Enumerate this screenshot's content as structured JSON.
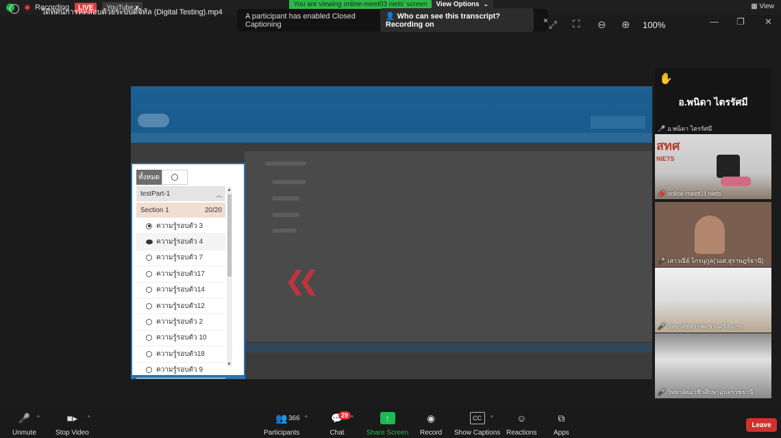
{
  "recording": {
    "label": "Recording",
    "live": "LIVE",
    "stream_target": "YouTube"
  },
  "share_banner": {
    "text": "You are viewing online-meet03 niets' screen",
    "view_options": "View Options"
  },
  "view_menu": "View",
  "file_title": "วีดิทัศน์การทดสอบด้วยระบบดิจิทัล (Digital Testing).mp4",
  "toast": {
    "message": "A participant has enabled Closed Captioning",
    "button": "Who can see this transcript? Recording on",
    "close": "×"
  },
  "zoom_level": "100%",
  "side_panel": {
    "tab_all": "ทั้งหมด",
    "part": "testPart-1",
    "section": "Section 1",
    "section_count": "20/20",
    "items": [
      {
        "label": "ความรู้รอบตัว 3",
        "state": "answered"
      },
      {
        "label": "ความรู้รอบตัว 4",
        "state": "viewed"
      },
      {
        "label": "ความรู้รอบตัว 7",
        "state": "unanswered"
      },
      {
        "label": "ความรู้รอบตัว17",
        "state": "unanswered"
      },
      {
        "label": "ความรู้รอบตัว14",
        "state": "unanswered"
      },
      {
        "label": "ความรู้รอบตัว12",
        "state": "unanswered"
      },
      {
        "label": "ความรู้รอบตัว 2",
        "state": "unanswered"
      },
      {
        "label": "ความรู้รอบตัว 10",
        "state": "unanswered"
      },
      {
        "label": "ความรู้รอบตัว18",
        "state": "unanswered"
      },
      {
        "label": "ความรู้รอบตัว 9",
        "state": "unanswered"
      }
    ]
  },
  "gallery": {
    "speaker": {
      "name": "อ.พนิดา  ไตรรัศมี",
      "label": "อ.พนิดา  ไตรรัศมี"
    },
    "tiles": [
      {
        "label": "online-meet03 niets",
        "logo_thai": "สทศ",
        "logo_en": "NIETS"
      },
      {
        "label": "เสาวณีย์ ไกรนุกูล(วอศ.สุราษฎร์ธานี)"
      },
      {
        "label": "วิทยาลัยสารพัดช่างศรีสะเกษ"
      },
      {
        "label": "วิทยาลัยอาชีวศึกษาอุบลราชธานี"
      }
    ]
  },
  "toolbar": {
    "unmute": "Unmute",
    "stop_video": "Stop Video",
    "participants": "Participants",
    "participants_count": "366",
    "chat": "Chat",
    "chat_badge": "29",
    "share_screen": "Share Screen",
    "record": "Record",
    "show_captions": "Show Captions",
    "reactions": "Reactions",
    "apps": "Apps",
    "leave": "Leave"
  },
  "colors": {
    "live_red": "#e03d3d",
    "share_green": "#2fb84a",
    "leave_red": "#d0312d",
    "panel_blue": "#2b73ad"
  }
}
